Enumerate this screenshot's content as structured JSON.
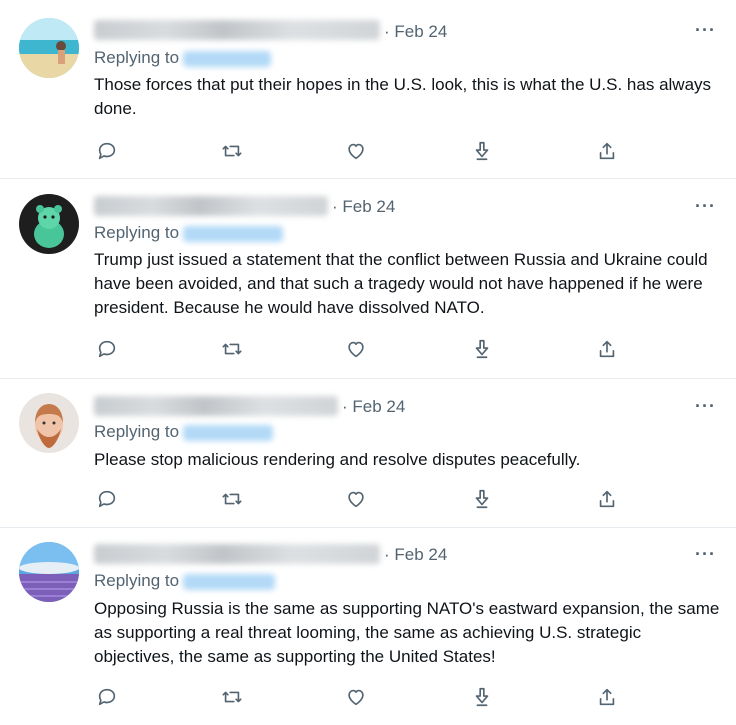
{
  "tweets": [
    {
      "date": "· Feb 24",
      "more": "···",
      "replying_to": "Replying to",
      "text": "Those forces that put their hopes in the U.S. look, this is what the U.S. has always done.",
      "avatar": "beach-photo"
    },
    {
      "date": "· Feb 24",
      "more": "···",
      "replying_to": "Replying to",
      "text": "Trump just issued a statement that the conflict between Russia and Ukraine could have been avoided, and that such a tragedy would not have happened if he were president. Because he would have dissolved NATO.",
      "avatar": "green-bear"
    },
    {
      "date": "· Feb 24",
      "more": "···",
      "replying_to": "Replying to",
      "text": "Please stop malicious rendering and resolve disputes peacefully.",
      "avatar": "bearded-man"
    },
    {
      "date": "· Feb 24",
      "more": "···",
      "replying_to": "Replying to",
      "text": "Opposing Russia is the same as supporting NATO's eastward expansion, the same as supporting a real threat looming, the same as achieving U.S. strategic objectives, the same as supporting the United States!",
      "avatar": "lavender-field"
    }
  ],
  "icons": [
    "reply-icon",
    "retweet-icon",
    "like-icon",
    "download-icon",
    "share-icon"
  ],
  "colors": {
    "secondary_text": "#536471",
    "primary_text": "#0f1419",
    "divider": "#e6ecf0",
    "handle_blur": "#9fd0f5"
  }
}
